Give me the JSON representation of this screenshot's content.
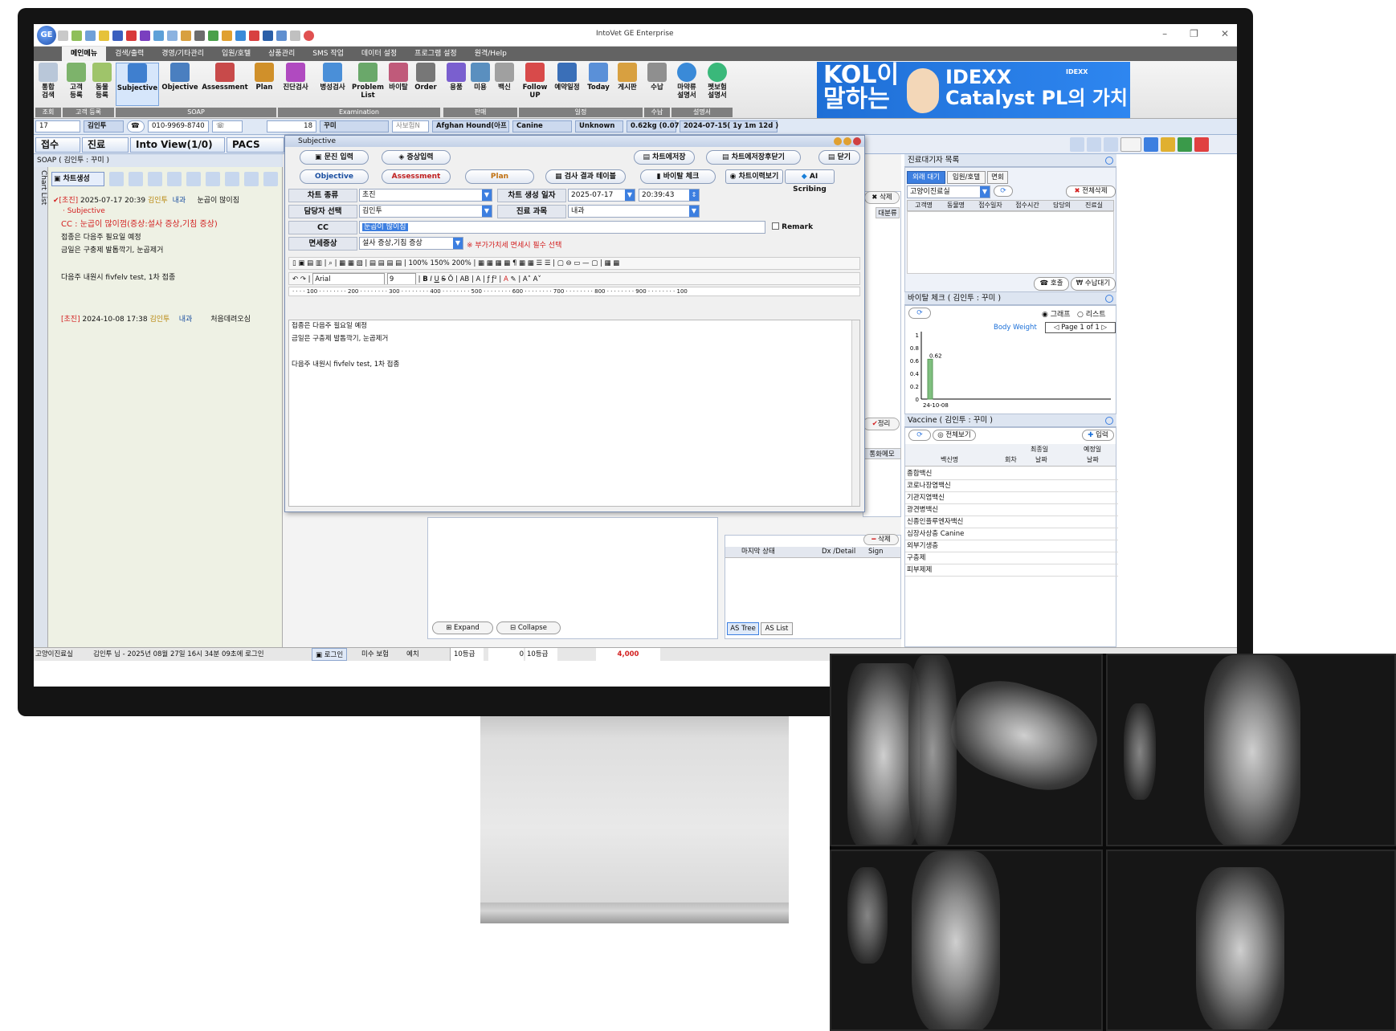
{
  "app": {
    "title": "IntoVet GE Enterprise",
    "logo": "GE"
  },
  "menu": [
    "메인메뉴",
    "검색/출력",
    "경영/기타관리",
    "입원/호텔",
    "상품관리",
    "SMS 작업",
    "데이터 설정",
    "프로그램 설정",
    "원격/Help"
  ],
  "ribbon": {
    "search": "통합\n검색",
    "customer_reg": "고객\n등록",
    "animal_reg": "동물\n등록",
    "subjective": "Subjective",
    "objective": "Objective",
    "assessment": "Assessment",
    "plan": "Plan",
    "diag": "진단검사",
    "path": "병성검사",
    "problem": "Problem\nList",
    "vital": "바이탈",
    "order": "Order",
    "supplies": "용품",
    "beauty": "미용",
    "vaccine": "백신",
    "followup": "Follow\nUP",
    "reservation": "예약일정",
    "today": "Today",
    "board": "게시판",
    "payment": "수납",
    "narcotics": "마약류\n설명서",
    "petins": "펫보험\n설명서",
    "groups": {
      "lookup": "조회",
      "customer": "고객 등록",
      "soap": "SOAP",
      "exam": "Examination",
      "sales": "판매",
      "schedule": "일정",
      "pay": "수납",
      "doc": "설명서"
    }
  },
  "ad": {
    "line1": "KOL이",
    "line2": "말하는",
    "brand": "IDEXX",
    "product": "Catalyst PL의 가치",
    "small": "IDEXX"
  },
  "patient": {
    "no": "17",
    "owner": "김인투",
    "phone": "010-9969-8740",
    "animal_no": "18",
    "animal": "꾸미",
    "insurance": "사보험N",
    "breed": "Afghan Hound(아프",
    "species": "Canine",
    "sex": "Unknown",
    "weight": "0.62kg (0.07",
    "birth": "2024-07-15( 1y 1m 12d )"
  },
  "tabs": {
    "reception": "접수",
    "treatment": "진료",
    "intoview": "Into View(1/0)",
    "pacs": "PACS"
  },
  "soap": {
    "header": "SOAP ( 김인투 : 꾸미 )",
    "chartlist": "Chart List",
    "create": "차트생성",
    "rec1": {
      "type": "[초진]",
      "datetime": "2025-07-17 20:39",
      "doctor": "김인투",
      "dept": "내과",
      "cc": "눈곱이 많이짐",
      "section": "· Subjective",
      "cc_line": "CC : 눈곱이 많이껌(증상:설사 증상,기침 증상)",
      "l1": "접종은 다음주 필요일 예정",
      "l2": "금일은 구충제 발톱깍기, 눈곱제거",
      "l3": "다음주 내원시 fivfelv test, 1차 접종"
    },
    "rec2": {
      "type": "[초진]",
      "datetime": "2024-10-08 17:38",
      "doctor": "김인투",
      "dept": "내과",
      "cc": "처음데려오심"
    }
  },
  "dialog": {
    "title": "Subjective",
    "btn_interview": "문진 입력",
    "btn_symptom": "증상입력",
    "btn_save": "차트에저장",
    "btn_saveclose": "차트에저장후닫기",
    "btn_close": "닫기",
    "btn_obj": "Objective",
    "btn_ass": "Assessment",
    "btn_plan": "Plan",
    "btn_labtable": "검사 결과 테이블",
    "btn_vital": "바이탈 체크",
    "btn_history": "차트이력보기",
    "btn_ai": "AI Scribing",
    "chart_type_label": "차트 종류",
    "chart_type": "초진",
    "date_label": "차트 생성 일자",
    "date": "2025-07-17",
    "time": "20:39:43",
    "staff_label": "담당자 선택",
    "staff": "김인투",
    "dept_label": "진료 과목",
    "dept": "내과",
    "cc_label": "CC",
    "cc": "눈곱이 많이짐",
    "remark": "Remark",
    "exempt_label": "면세증상",
    "exempt": "설사 증상,기침 증상",
    "vat_note": "※ 부가가치세 면세시 필수 선택",
    "zoom": "100%  150%  200%",
    "font": "Arial",
    "size": "9",
    "ruler": "· · · · 100 · · · · · · · · 200 · · · · · · · · 300 · · · · · · · · 400 · · · · · · · · 500 · · · · · · · · 600 · · · · · · · · 700 · · · · · · · · 800 · · · · · · · · 900 · · · · · · · · 100",
    "text1": "접종은 다음주 필요일 예정",
    "text2": "금일은 구충제 발톱깍기, 눈곱제거",
    "text3": "다음주 내원시 fivfelv test, 1차 접종"
  },
  "mid": {
    "delete": "삭제",
    "category": "대분류",
    "arrange": "정리",
    "phonememo": "통화메모",
    "delete2": "삭제",
    "col_status": "마지막 상태",
    "col_dx": "Dx /Detail",
    "col_sign": "Sign",
    "astree": "AS Tree",
    "aslist": "AS List",
    "expand": "Expand",
    "collapse": "Collapse"
  },
  "waitlist": {
    "header": "진료대기자 목록",
    "tab_out": "외래 대기",
    "tab_hotel": "입원/호텔",
    "tab_visit": "면회",
    "room": "고양이진료실",
    "delete_all": "전체삭제",
    "cols": [
      "고객명",
      "동물명",
      "접수일자",
      "접수시간",
      "담당의",
      "진료실"
    ],
    "call": "호출",
    "pay_wait": "수납대기"
  },
  "vital": {
    "header": "바이탈 체크 ( 김인투 : 꾸미 )",
    "graph": "그래프",
    "list": "리스트",
    "series": "Body Weight",
    "page": "Page 1 of 1"
  },
  "chart_data": {
    "type": "bar",
    "title": "Body Weight",
    "categories": [
      "24-10-08"
    ],
    "values": [
      0.62
    ],
    "ylim": [
      0,
      1
    ],
    "yticks": [
      "1",
      "0.8",
      "0.6",
      "0.4",
      "0.2",
      "0"
    ],
    "data_labels": [
      "0.62"
    ]
  },
  "vaccine": {
    "header": "Vaccine ( 김인투 : 꾸미 )",
    "view_all": "전체보기",
    "add": "입력",
    "col_last": "최종일",
    "col_due": "예정일",
    "col_name": "백신명",
    "col_count": "회차",
    "col_date": "날짜",
    "col_date2": "날짜",
    "rows": [
      "종합백신",
      "코로나장염백신",
      "기관지염백신",
      "광견병백신",
      "신종인플루엔자백신",
      "심장사상충 Canine",
      "외부기생충",
      "구충제",
      "피부제제"
    ]
  },
  "status": {
    "room": "고양이진료실",
    "login": "김인투 님 - 2025년 08월 27일 16시 34분 09초에 로그인",
    "btn_login": "로그인",
    "unpaid": "미수 보험",
    "deposit": "예치",
    "grade1": "10등급",
    "zero": "0",
    "grade2": "10등급",
    "amount": "4,000"
  },
  "colors": {
    "accent": "#3d7fe0",
    "menubar": "#636363",
    "red": "#d32020"
  }
}
